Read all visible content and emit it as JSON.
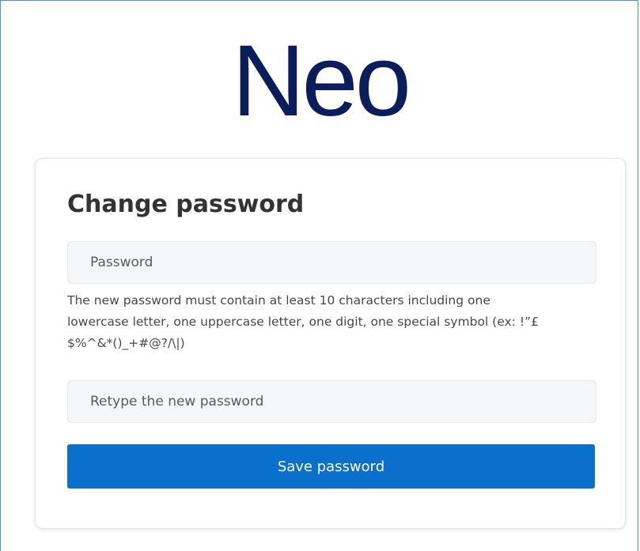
{
  "brand": {
    "logo_text": "Neo",
    "logo_color": "#0b1e5b"
  },
  "form": {
    "title": "Change password",
    "password": {
      "value": "",
      "placeholder": "Password"
    },
    "hint": "The new password must contain at least 10 characters including one lowercase letter, one uppercase letter, one digit, one special symbol (ex: !”£ $%^&*()_+#@?/\\|)",
    "retype": {
      "value": "",
      "placeholder": "Retype the new password"
    },
    "save_label": "Save password",
    "button_color": "#0b6fcc"
  }
}
